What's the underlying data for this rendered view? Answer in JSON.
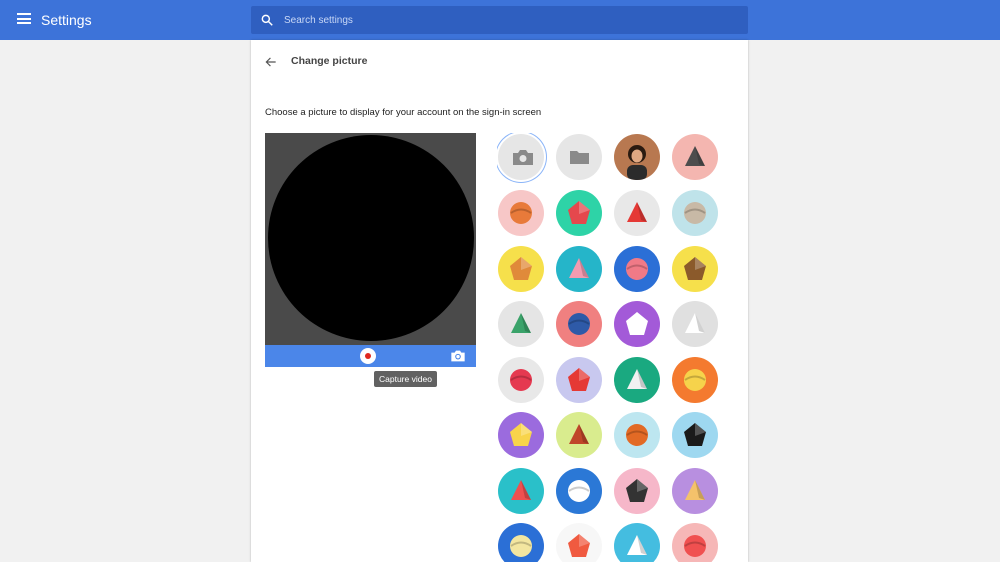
{
  "header": {
    "title": "Settings",
    "search_placeholder": "Search settings"
  },
  "page": {
    "title": "Change picture",
    "description": "Choose a picture to display for your account on the sign-in screen"
  },
  "camera": {
    "tooltip": "Capture video"
  },
  "colors": {
    "header_bg": "#3d73d9",
    "search_bg": "#2f5fc0",
    "camera_bar": "#4b86e9",
    "record_dot": "#e0281f"
  },
  "pictures": [
    {
      "name": "take-photo-option",
      "bg": "#e6e6e6",
      "fg": "#8a8a8a",
      "kind": "camera",
      "selected": true
    },
    {
      "name": "choose-file-option",
      "bg": "#e6e6e6",
      "fg": "#8a8a8a",
      "kind": "folder"
    },
    {
      "name": "profile-photo",
      "bg": "#b87850",
      "fg": "#2a1a10",
      "kind": "person"
    },
    {
      "name": "penguin-avatar",
      "bg": "#f4b6b0",
      "fg": "#4d4d4d",
      "kind": "shape"
    },
    {
      "name": "fox-avatar",
      "bg": "#f7c7c7",
      "fg": "#e87a3a",
      "kind": "shape"
    },
    {
      "name": "watermelon-avatar",
      "bg": "#2ed3a7",
      "fg": "#e5484d",
      "kind": "shape"
    },
    {
      "name": "red-bird-avatar",
      "bg": "#e8e8e8",
      "fg": "#e53935",
      "kind": "shape"
    },
    {
      "name": "cat-avatar",
      "bg": "#bfe3ea",
      "fg": "#c8b9a6",
      "kind": "shape"
    },
    {
      "name": "dog-avatar",
      "bg": "#f6e04b",
      "fg": "#e08a3a",
      "kind": "shape"
    },
    {
      "name": "rabbit-avatar",
      "bg": "#25b5c9",
      "fg": "#f29bb0",
      "kind": "shape"
    },
    {
      "name": "butterfly-avatar",
      "bg": "#2b6fd6",
      "fg": "#f07a87",
      "kind": "shape"
    },
    {
      "name": "monkey-avatar",
      "bg": "#f6e04b",
      "fg": "#8b5a2b",
      "kind": "shape"
    },
    {
      "name": "dragon-avatar",
      "bg": "#e5e5e5",
      "fg": "#3aa36a",
      "kind": "shape"
    },
    {
      "name": "elephant-avatar",
      "bg": "#f08080",
      "fg": "#2e5aa8",
      "kind": "shape"
    },
    {
      "name": "panda-avatar",
      "bg": "#a35ad8",
      "fg": "#ffffff",
      "kind": "shape"
    },
    {
      "name": "unicorn-avatar",
      "bg": "#e0e0e0",
      "fg": "#ffffff",
      "kind": "shape"
    },
    {
      "name": "birds-avatar",
      "bg": "#e8e8e8",
      "fg": "#e53950",
      "kind": "shape"
    },
    {
      "name": "cardinal-avatar",
      "bg": "#c8c8ef",
      "fg": "#e53935",
      "kind": "shape"
    },
    {
      "name": "plate-avatar",
      "bg": "#1aa980",
      "fg": "#f1f1f1",
      "kind": "shape"
    },
    {
      "name": "egg-avatar",
      "bg": "#f47a2f",
      "fg": "#f6d34b",
      "kind": "shape"
    },
    {
      "name": "cheese-avatar",
      "bg": "#9b6bde",
      "fg": "#f8d44b",
      "kind": "shape"
    },
    {
      "name": "football-avatar",
      "bg": "#d9ec8e",
      "fg": "#c0462a",
      "kind": "shape"
    },
    {
      "name": "basketball-avatar",
      "bg": "#bde6f0",
      "fg": "#e26a25",
      "kind": "shape"
    },
    {
      "name": "vinyl-record-avatar",
      "bg": "#9ed8f0",
      "fg": "#1a1a1a",
      "kind": "shape"
    },
    {
      "name": "sushi-avatar",
      "bg": "#2ac0c9",
      "fg": "#f05050",
      "kind": "shape"
    },
    {
      "name": "bicycle-avatar",
      "bg": "#2b78d6",
      "fg": "#ffffff",
      "kind": "shape"
    },
    {
      "name": "sunglasses-avatar",
      "bg": "#f6b7c9",
      "fg": "#333333",
      "kind": "shape"
    },
    {
      "name": "pizza-avatar",
      "bg": "#b88fe0",
      "fg": "#f4c26b",
      "kind": "shape"
    },
    {
      "name": "sandwich-avatar",
      "bg": "#2b6fd6",
      "fg": "#f3e6a0",
      "kind": "shape"
    },
    {
      "name": "smile-avatar",
      "bg": "#f7f7f7",
      "fg": "#f05a40",
      "kind": "shape"
    },
    {
      "name": "shapes-avatar",
      "bg": "#44bde0",
      "fg": "#ffffff",
      "kind": "shape"
    },
    {
      "name": "ice-cream-avatar",
      "bg": "#f6b7b7",
      "fg": "#f05050",
      "kind": "shape"
    }
  ]
}
